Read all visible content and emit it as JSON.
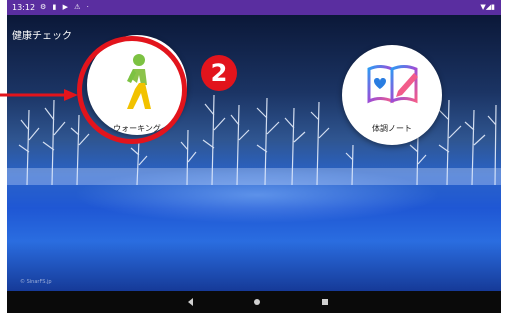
{
  "status_bar": {
    "time": "13:12",
    "left_icons": "⚙ ▮ ▶ ⚠ ·",
    "right_icons": "▼◢▮"
  },
  "app": {
    "title": "健康チェック"
  },
  "tiles": [
    {
      "label": "ウォーキング",
      "icon": "walking-person-icon"
    },
    {
      "label": "体調ノート",
      "icon": "notebook-heart-icon"
    }
  ],
  "annotation": {
    "badge": "2",
    "color": "#e2141c"
  },
  "watermark": "© SinarFS.jp",
  "colors": {
    "status_bar": "#5a2ea0",
    "accent_red": "#e2141c",
    "walker_green": "#7cc242",
    "walker_yellow": "#f2c200"
  },
  "nav_icons": [
    "back-icon",
    "home-icon",
    "recents-icon"
  ]
}
